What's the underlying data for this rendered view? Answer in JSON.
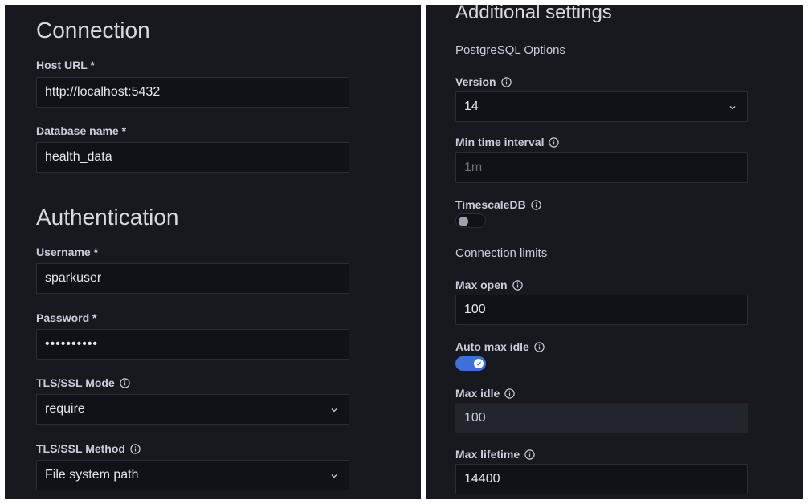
{
  "connection": {
    "title": "Connection",
    "host_url": {
      "label": "Host URL *",
      "value": "http://localhost:5432"
    },
    "database_name": {
      "label": "Database name *",
      "value": "health_data"
    }
  },
  "authentication": {
    "title": "Authentication",
    "username": {
      "label": "Username *",
      "value": "sparkuser"
    },
    "password": {
      "label": "Password *",
      "value": "••••••••••"
    },
    "tls_mode": {
      "label": "TLS/SSL Mode",
      "value": "require"
    },
    "tls_method": {
      "label": "TLS/SSL Method",
      "value": "File system path"
    }
  },
  "additional": {
    "title": "Additional settings",
    "postgres_options": "PostgreSQL Options",
    "version": {
      "label": "Version",
      "value": "14"
    },
    "min_time_interval": {
      "label": "Min time interval",
      "placeholder": "1m"
    },
    "timescaledb": {
      "label": "TimescaleDB",
      "enabled": false
    },
    "connection_limits": "Connection limits",
    "max_open": {
      "label": "Max open",
      "value": "100"
    },
    "auto_max_idle": {
      "label": "Auto max idle",
      "enabled": true
    },
    "max_idle": {
      "label": "Max idle",
      "value": "100"
    },
    "max_lifetime": {
      "label": "Max lifetime",
      "value": "14400"
    }
  },
  "icons": {
    "info": "info-circle-icon",
    "chevron": "chevron-down-icon",
    "check": "check-icon"
  },
  "colors": {
    "panel_bg": "#18191e",
    "input_bg": "#111217",
    "border": "#2b2d36",
    "toggle_on": "#3d71d9",
    "text": "#ccccdc"
  }
}
